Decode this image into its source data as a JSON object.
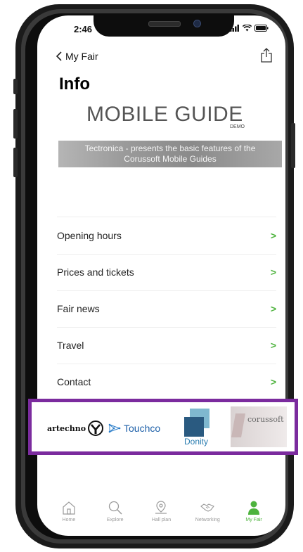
{
  "status_bar": {
    "time": "2:46"
  },
  "nav": {
    "back_label": "My Fair"
  },
  "page": {
    "title": "Info"
  },
  "banner": {
    "title": "MOBILE GUIDE",
    "tag": "DEMO",
    "subtitle": "Tectronica - presents the basic features of the Corussoft Mobile Guides"
  },
  "menu": [
    {
      "label": "Opening hours"
    },
    {
      "label": "Prices and tickets"
    },
    {
      "label": "Fair news"
    },
    {
      "label": "Travel"
    },
    {
      "label": "Contact"
    }
  ],
  "sponsors": [
    {
      "name": "artechno"
    },
    {
      "name": "Touchco"
    },
    {
      "name": "Donity"
    },
    {
      "name": "corussoft"
    }
  ],
  "tabs": [
    {
      "label": "Home",
      "icon": "home-icon"
    },
    {
      "label": "Explore",
      "icon": "search-icon"
    },
    {
      "label": "Hall plan",
      "icon": "map-pin-icon"
    },
    {
      "label": "Networking",
      "icon": "handshake-icon"
    },
    {
      "label": "My Fair",
      "icon": "person-icon",
      "active": true
    }
  ],
  "colors": {
    "accent": "#4db33d",
    "sponsor_border": "#7b2b9e",
    "frame": "#1b1b1b"
  }
}
